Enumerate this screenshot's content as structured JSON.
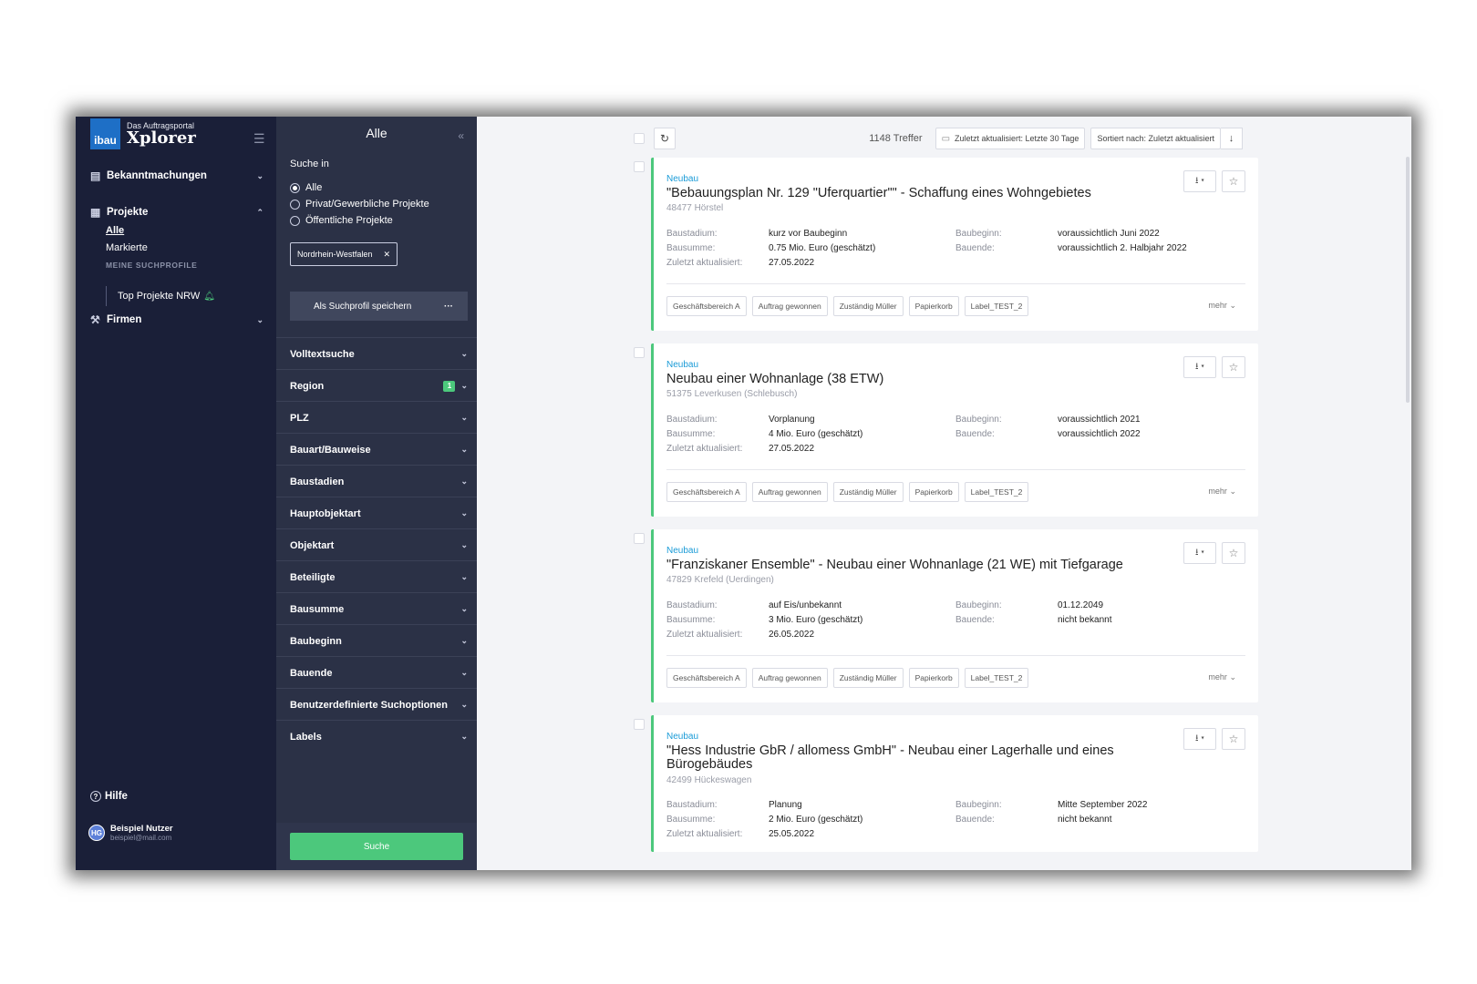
{
  "nav": {
    "logo_box": "ibau",
    "logo_sub": "Das Auftragsportal",
    "logo_main": "Xplorer",
    "bekanntmachungen": "Bekanntmachungen",
    "projekte": "Projekte",
    "sub_alle": "Alle",
    "sub_markierte": "Markierte",
    "meine_suchprofile": "MEINE SUCHPROFILE",
    "profile_name": "Top Projekte NRW",
    "firmen": "Firmen",
    "hilfe": "Hilfe",
    "user_initials": "HG",
    "user_name": "Beispiel Nutzer",
    "user_email": "beispiel@mail.com"
  },
  "filter": {
    "title": "Alle",
    "suche_in": "Suche in",
    "radios": [
      "Alle",
      "Privat/Gewerbliche Projekte",
      "Öffentliche Projekte"
    ],
    "selected_radio": "Alle",
    "region_chip": "Nordrhein-Westfalen",
    "save_profile": "Als Suchprofil speichern",
    "sections": [
      "Volltextsuche",
      "Region",
      "PLZ",
      "Bauart/Bauweise",
      "Baustadien",
      "Hauptobjektart",
      "Objektart",
      "Beteiligte",
      "Bausumme",
      "Baubeginn",
      "Bauende",
      "Benutzerdefinierte Suchoptionen",
      "Labels"
    ],
    "region_badge": "1",
    "search_button": "Suche"
  },
  "toolbar": {
    "hits": "1148 Treffer",
    "updated_filter": "Zuletzt aktualisiert: Letzte 30 Tage",
    "sort": "Sortiert nach: Zuletzt aktualisiert"
  },
  "labels": {
    "baustadium": "Baustadium:",
    "bausumme": "Bausumme:",
    "zuletzt": "Zuletzt aktualisiert:",
    "baubeginn": "Baubeginn:",
    "bauende": "Bauende:",
    "mehr": "mehr"
  },
  "tags": [
    "Geschäftsbereich A",
    "Auftrag gewonnen",
    "Zuständig Müller",
    "Papierkorb",
    "Label_TEST_2"
  ],
  "projects": [
    {
      "type": "Neubau",
      "title": "\"Bebauungsplan Nr. 129 \"Uferquartier\"\" - Schaffung eines Wohngebietes",
      "location": "48477 Hörstel",
      "baustadium": "kurz vor Baubeginn",
      "bausumme": "0.75 Mio. Euro (geschätzt)",
      "zuletzt": "27.05.2022",
      "baubeginn": "voraussichtlich Juni 2022",
      "bauende": "voraussichtlich 2. Halbjahr 2022"
    },
    {
      "type": "Neubau",
      "title": "Neubau einer Wohnanlage (38 ETW)",
      "location": "51375 Leverkusen (Schlebusch)",
      "baustadium": "Vorplanung",
      "bausumme": "4 Mio. Euro (geschätzt)",
      "zuletzt": "27.05.2022",
      "baubeginn": "voraussichtlich 2021",
      "bauende": "voraussichtlich 2022"
    },
    {
      "type": "Neubau",
      "title": "\"Franziskaner Ensemble\" - Neubau einer Wohnanlage (21 WE) mit Tiefgarage",
      "location": "47829 Krefeld (Uerdingen)",
      "baustadium": "auf Eis/unbekannt",
      "bausumme": "3 Mio. Euro (geschätzt)",
      "zuletzt": "26.05.2022",
      "baubeginn": "01.12.2049",
      "bauende": "nicht bekannt"
    },
    {
      "type": "Neubau",
      "title": "\"Hess Industrie GbR / allomess GmbH\" - Neubau einer Lagerhalle und eines Bürogebäudes",
      "location": "42499 Hückeswagen",
      "baustadium": "Planung",
      "bausumme": "2 Mio. Euro (geschätzt)",
      "zuletzt": "25.05.2022",
      "baubeginn": "Mitte September 2022",
      "bauende": "nicht bekannt"
    }
  ]
}
